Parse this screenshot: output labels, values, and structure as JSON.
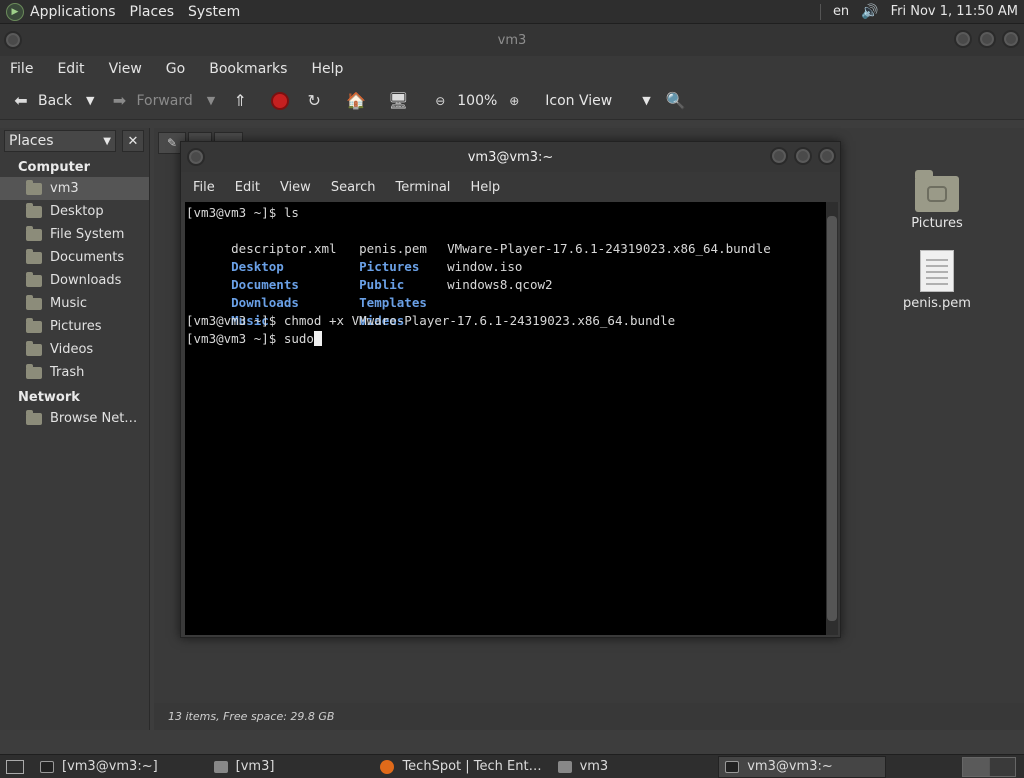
{
  "top_panel": {
    "menus": [
      "Applications",
      "Places",
      "System"
    ],
    "keyboard": "en",
    "clock": "Fri Nov 1, 11:50 AM"
  },
  "file_manager": {
    "title": "vm3",
    "menu": [
      "File",
      "Edit",
      "View",
      "Go",
      "Bookmarks",
      "Help"
    ],
    "toolbar": {
      "back": "Back",
      "forward": "Forward",
      "zoom": "100%",
      "view_mode": "Icon View"
    },
    "sidebar": {
      "selector": "Places",
      "sections": [
        {
          "title": "Computer",
          "items": [
            "vm3",
            "Desktop",
            "File System",
            "Documents",
            "Downloads",
            "Music",
            "Pictures",
            "Videos",
            "Trash"
          ]
        },
        {
          "title": "Network",
          "items": [
            "Browse Net…"
          ]
        }
      ],
      "active_item": "vm3"
    },
    "desktop_icons": [
      {
        "label": "Pictures",
        "type": "folder"
      },
      {
        "label": "penis.pem",
        "type": "document"
      }
    ],
    "status": "13 items, Free space: 29.8 GB"
  },
  "terminal": {
    "title": "vm3@vm3:~",
    "menu": [
      "File",
      "Edit",
      "View",
      "Search",
      "Terminal",
      "Help"
    ],
    "lines": {
      "prompt1": "[vm3@vm3 ~]$ ls",
      "ls_row1": [
        "descriptor.xml",
        "penis.pem",
        "VMware-Player-17.6.1-24319023.x86_64.bundle"
      ],
      "ls_row2": [
        "Desktop",
        "Pictures",
        "window.iso"
      ],
      "ls_row3": [
        "Documents",
        "Public",
        "windows8.qcow2"
      ],
      "ls_row4": [
        "Downloads",
        "Templates"
      ],
      "ls_row5": [
        "Music",
        "Videos"
      ],
      "prompt2": "[vm3@vm3 ~]$ chmod +x VMware-Player-17.6.1-24319023.x86_64.bundle",
      "prompt3": "[vm3@vm3 ~]$ sudo"
    }
  },
  "taskbar": {
    "tasks": [
      "[vm3@vm3:~]",
      "[vm3]",
      "TechSpot | Tech Ent…",
      "vm3",
      "vm3@vm3:~"
    ],
    "active_task": "vm3@vm3:~"
  }
}
